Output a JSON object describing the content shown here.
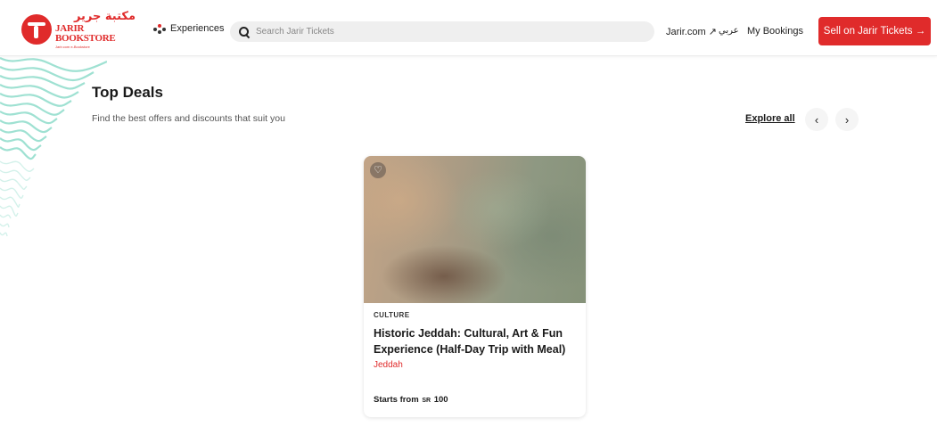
{
  "header": {
    "logo": {
      "arabic_text": "مكتبة جرير",
      "english_text": "JARIR BOOKSTORE",
      "sub_text": "Jarir.com e-Bookstore"
    },
    "nav_experiences": "Experiences",
    "search": {
      "placeholder": "Search Jarir Tickets",
      "value": ""
    },
    "jarir_link": "Jarir.com ↗",
    "arabic_link": "عربي",
    "bookings_link": "My Bookings",
    "sell_button": "Sell on Jarir Tickets →"
  },
  "deals": {
    "title": "Top Deals",
    "subtitle": "Find the best offers and discounts that suit you",
    "explore_all": "Explore all",
    "prev_arrow": "‹",
    "next_arrow": "›"
  },
  "card": {
    "category": "CULTURE",
    "title": "Historic Jeddah: Cultural, Art & Fun Experience (Half-Day Trip with Meal)",
    "city": "Jeddah",
    "price_prefix": "Starts from",
    "currency": "SR",
    "price": "100",
    "favorite_icon": "heart-icon"
  },
  "colors": {
    "brand_red": "#e02b2b",
    "wave_teal": "#7fd7c4"
  }
}
